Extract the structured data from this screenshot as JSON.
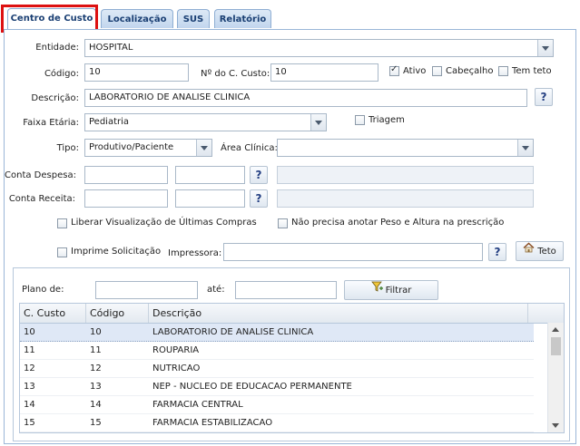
{
  "tabs": [
    "Centro de Custo",
    "Localização",
    "SUS",
    "Relatório"
  ],
  "form": {
    "entidade_label": "Entidade:",
    "entidade_value": "HOSPITAL",
    "codigo_label": "Código:",
    "codigo_value": "10",
    "nro_cc_label": "Nº do C. Custo:",
    "nro_cc_value": "10",
    "ativo_label": "Ativo",
    "cabecalho_label": "Cabeçalho",
    "tem_teto_label": "Tem teto",
    "descricao_label": "Descrição:",
    "descricao_value": "LABORATORIO DE ANALISE CLINICA",
    "faixa_label": "Faixa Etária:",
    "faixa_value": "Pediatria",
    "triagem_label": "Triagem",
    "tipo_label": "Tipo:",
    "tipo_value": "Produtivo/Paciente",
    "area_label": "Área Clínica:",
    "area_value": "",
    "conta_despesa_label": "Conta Despesa:",
    "conta_receita_label": "Conta Receita:",
    "liberar_label": "Liberar Visualização de Últimas Compras",
    "nao_precisa_label": "Não precisa anotar Peso e Altura na prescrição",
    "imprime_label": "Imprime Solicitação",
    "impressora_label": "Impressora:",
    "teto_button": "Teto",
    "help_glyph": "?"
  },
  "filter": {
    "plano_label": "Plano de:",
    "ate_label": "até:",
    "filtrar_button": "Filtrar"
  },
  "grid": {
    "headers": [
      "C. Custo",
      "Código",
      "Descrição"
    ],
    "rows": [
      [
        "10",
        "10",
        "LABORATORIO DE ANALISE CLINICA"
      ],
      [
        "11",
        "11",
        "ROUPARIA"
      ],
      [
        "12",
        "12",
        "NUTRICAO"
      ],
      [
        "13",
        "13",
        "NEP - NUCLEO DE EDUCACAO PERMANENTE"
      ],
      [
        "14",
        "14",
        "FARMACIA CENTRAL"
      ],
      [
        "15",
        "15",
        "FARMACIA ESTABILIZACAO"
      ]
    ]
  },
  "colors": {
    "accent": "#1a3f73",
    "highlight": "#dd1111",
    "selected_row": "#dfe8f6"
  }
}
